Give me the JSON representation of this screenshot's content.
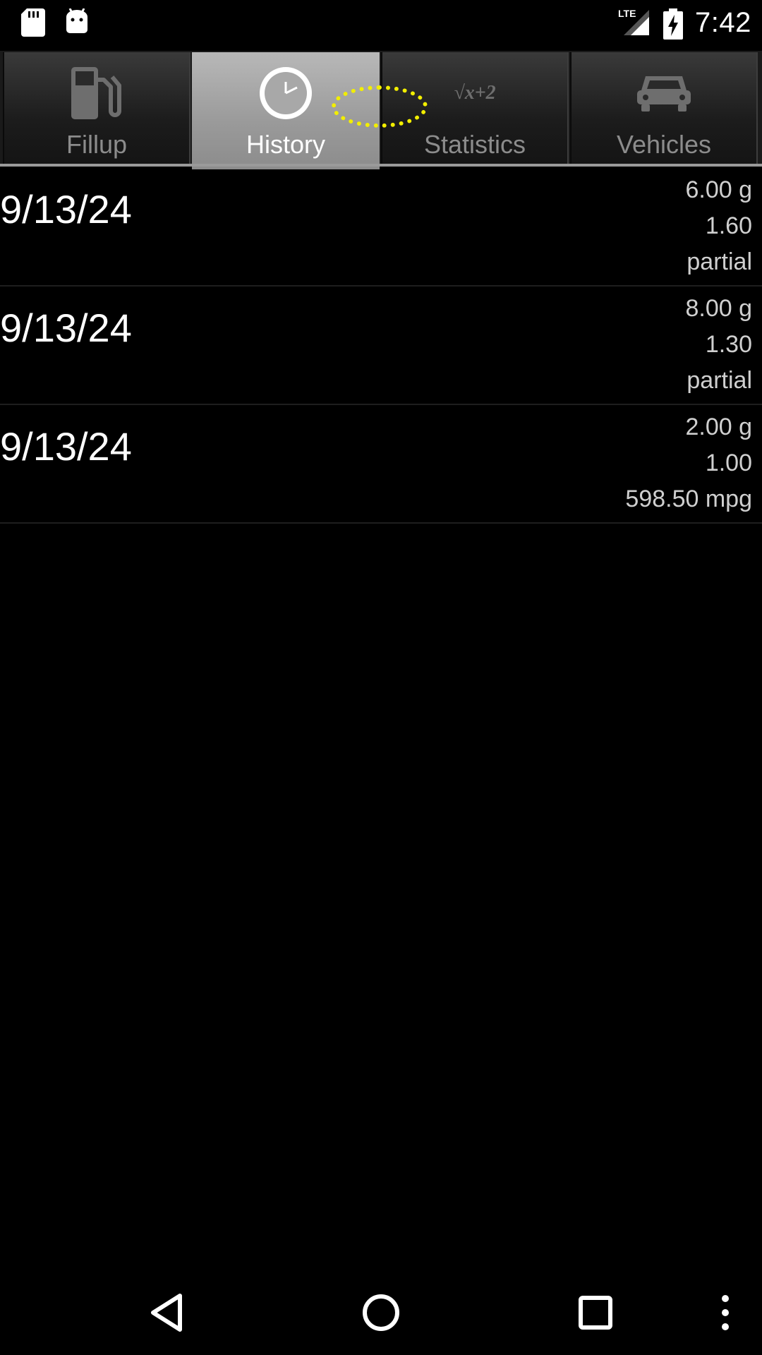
{
  "status_bar": {
    "time": "7:42",
    "network": "LTE",
    "left_icons": [
      "sd-card-icon",
      "android-icon"
    ],
    "right_icons": [
      "lte-signal-icon",
      "battery-charging-icon"
    ]
  },
  "tabs": [
    {
      "label": "Fillup",
      "icon": "fuel-pump-icon",
      "selected": false
    },
    {
      "label": "History",
      "icon": "clock-icon",
      "selected": true
    },
    {
      "label": "Statistics",
      "icon": "formula-icon",
      "icon_text": "√x+2",
      "selected": false
    },
    {
      "label": "Vehicles",
      "icon": "car-icon",
      "selected": false
    }
  ],
  "history": {
    "rows": [
      {
        "date": "9/13/24",
        "gallons": "6.00 g",
        "price": "1.60",
        "economy": "partial"
      },
      {
        "date": "9/13/24",
        "gallons": "8.00 g",
        "price": "1.30",
        "economy": "partial"
      },
      {
        "date": "9/13/24",
        "gallons": "2.00 g",
        "price": "1.00",
        "economy": "598.50 mpg"
      }
    ]
  },
  "nav_bar": {
    "buttons": [
      "back-icon",
      "home-icon",
      "recents-icon",
      "overflow-menu-icon"
    ]
  },
  "colors": {
    "background": "#000000",
    "tab_selected": "#9a9a9a",
    "tab_unselected": "#1c1c1c",
    "annotation": "#f2ee00"
  }
}
